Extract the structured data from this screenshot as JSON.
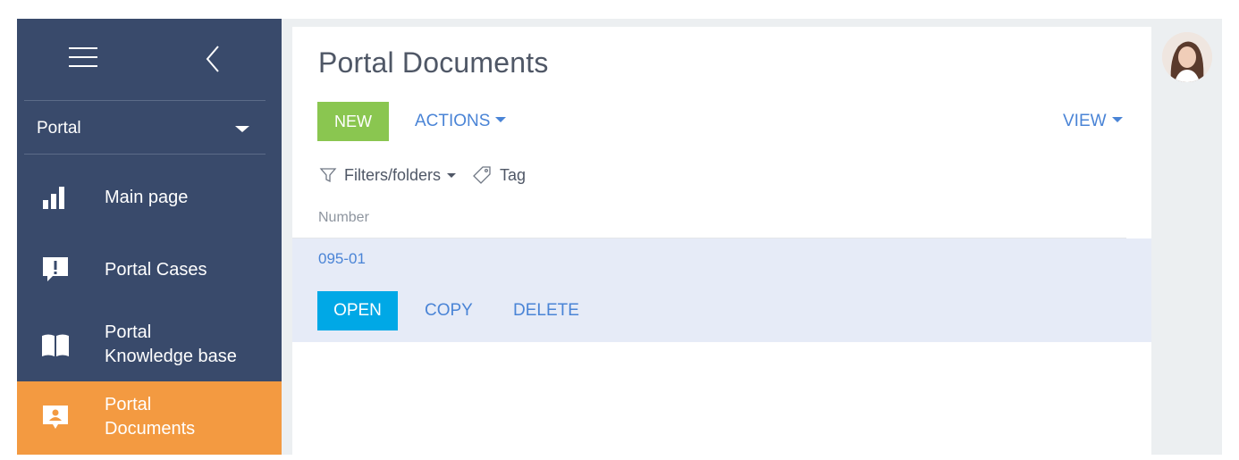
{
  "sidebar": {
    "workplace": "Portal",
    "items": [
      {
        "id": "main-page",
        "line1": "Main page",
        "line2": ""
      },
      {
        "id": "portal-cases",
        "line1": "Portal Cases",
        "line2": ""
      },
      {
        "id": "portal-knowledge-base",
        "line1": "Portal",
        "line2": "Knowledge base"
      },
      {
        "id": "portal-documents",
        "line1": "Portal",
        "line2": "Documents"
      }
    ]
  },
  "main": {
    "title": "Portal Documents",
    "toolbar": {
      "new_label": "NEW",
      "actions_label": "ACTIONS",
      "view_label": "VIEW"
    },
    "filters": {
      "filters_label": "Filters/folders",
      "tag_label": "Tag"
    },
    "table": {
      "columns": [
        "Number"
      ],
      "rows": [
        {
          "number": "095-01"
        }
      ],
      "row_actions": {
        "open": "OPEN",
        "copy": "COPY",
        "delete": "DELETE"
      }
    }
  },
  "colors": {
    "sidebar": "#394a6b",
    "active_nav": "#f39a41",
    "new_button": "#8ac650",
    "open_button": "#00a8e6",
    "link": "#4a84d6",
    "selected_row": "#e6ebf7"
  }
}
